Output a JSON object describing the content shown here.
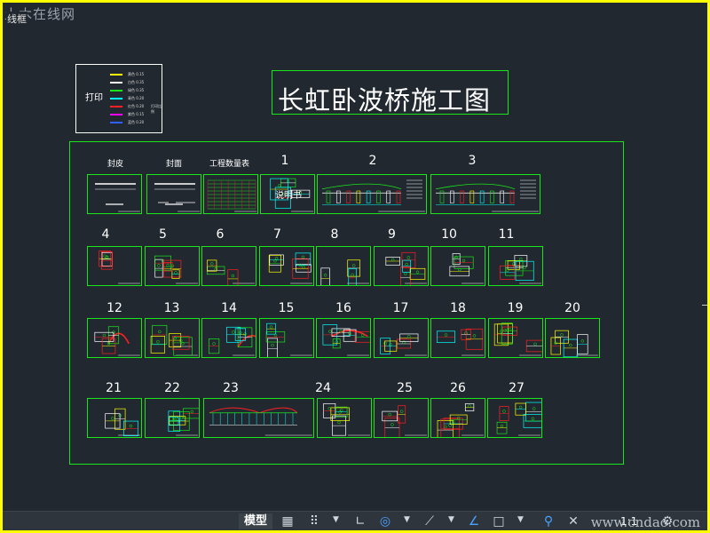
{
  "watermark_top": "土木在线网",
  "viewport_label": "线框",
  "legend": {
    "title": "打印",
    "rows": [
      {
        "color": "#ffff00",
        "label": "黄色 0.15"
      },
      {
        "color": "#ffffff",
        "label": "白色 0.35"
      },
      {
        "color": "#19e619",
        "label": "绿色 0.35"
      },
      {
        "color": "#00ffff",
        "label": "青色 0.20"
      },
      {
        "color": "#ff2020",
        "label": "红色 0.20"
      },
      {
        "color": "#ff00ff",
        "label": "紫色 0.15"
      },
      {
        "color": "#3060ff",
        "label": "蓝色 0.20"
      }
    ],
    "note": "打印比例"
  },
  "title": "长虹卧波桥施工图",
  "sheets_row0": [
    {
      "num": "封皮",
      "type": "cover"
    },
    {
      "num": "封面",
      "type": "cover2"
    },
    {
      "num": "工程数量表",
      "type": "table"
    },
    {
      "num": "1",
      "type": "text",
      "text": "说明书"
    },
    {
      "num": "2",
      "type": "elev"
    },
    {
      "num": "3",
      "type": "elev2"
    }
  ],
  "sheets_row1": [
    "4",
    "5",
    "6",
    "7",
    "8",
    "9",
    "10",
    "11"
  ],
  "sheets_row2": [
    "12",
    "13",
    "14",
    "15",
    "16",
    "17",
    "18",
    "19",
    "20"
  ],
  "sheets_row3": [
    "21",
    "22",
    "23",
    "24",
    "25",
    "26",
    "27"
  ],
  "statusbar": {
    "model_tab": "模型",
    "scale": "1:1",
    "watermark": "www.cndao.com"
  }
}
